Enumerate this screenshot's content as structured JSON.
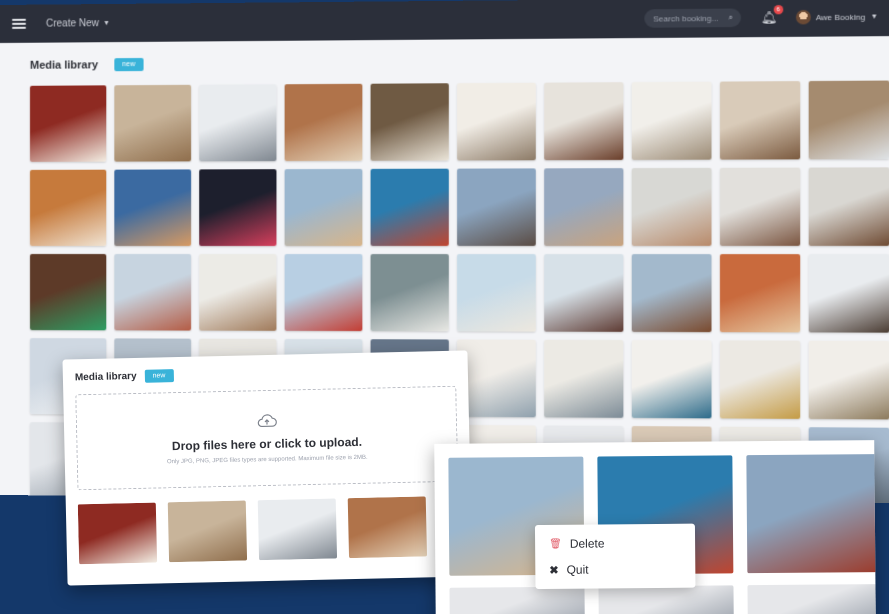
{
  "topbar": {
    "create_new_label": "Create New",
    "search_placeholder": "Search booking...",
    "notification_count": "6",
    "user_name": "Awe Booking"
  },
  "library": {
    "title": "Media library",
    "new_label": "new",
    "tiles": [
      {
        "colors": [
          "#8e2a22",
          "#f3ede3"
        ],
        "name": "media-tile-cafe-red"
      },
      {
        "colors": [
          "#c8b49a",
          "#8f6e4c"
        ],
        "name": "media-tile-office-hall"
      },
      {
        "colors": [
          "#e9ecef",
          "#7f8790"
        ],
        "name": "media-tile-living-gray"
      },
      {
        "colors": [
          "#b0734a",
          "#e3d1b8"
        ],
        "name": "media-tile-library-room"
      },
      {
        "colors": [
          "#6f5a43",
          "#eae4d8"
        ],
        "name": "media-tile-loft-living"
      },
      {
        "colors": [
          "#f1ede6",
          "#8c7a66"
        ],
        "name": "media-tile-dining"
      },
      {
        "colors": [
          "#e7e3dc",
          "#6a3e2a"
        ],
        "name": "media-tile-fireplace"
      },
      {
        "colors": [
          "#f1efea",
          "#9b8a74"
        ],
        "name": "media-tile-studio"
      },
      {
        "colors": [
          "#d9cbb9",
          "#7b5a3f"
        ],
        "name": "media-tile-lounge"
      },
      {
        "colors": [
          "#a58b6f",
          "#dfe3e6"
        ],
        "name": "media-tile-restaurant"
      },
      {
        "colors": [
          "#c67a3c",
          "#f0e3d2"
        ],
        "name": "media-tile-workspace"
      },
      {
        "colors": [
          "#3b6aa1",
          "#d79a62"
        ],
        "name": "media-tile-street-flags"
      },
      {
        "colors": [
          "#1d1f2d",
          "#d63f5c"
        ],
        "name": "media-tile-times-square"
      },
      {
        "colors": [
          "#9bb7cf",
          "#d8b58a"
        ],
        "name": "media-tile-beach"
      },
      {
        "colors": [
          "#2b7cae",
          "#c0452f"
        ],
        "name": "media-tile-golden-gate"
      },
      {
        "colors": [
          "#8ba5c0",
          "#5a4c44"
        ],
        "name": "media-tile-city-chicago"
      },
      {
        "colors": [
          "#96a8bf",
          "#c9a37e"
        ],
        "name": "media-tile-downtown"
      },
      {
        "colors": [
          "#d8d8d4",
          "#b88a6a"
        ],
        "name": "media-tile-man-glasses"
      },
      {
        "colors": [
          "#e2e0dc",
          "#7a5540"
        ],
        "name": "media-tile-woman-smile"
      },
      {
        "colors": [
          "#d9d7d2",
          "#6e4a32"
        ],
        "name": "media-tile-man-beard"
      },
      {
        "colors": [
          "#5d3a28",
          "#2e9d63"
        ],
        "name": "media-tile-man-green"
      },
      {
        "colors": [
          "#c7d4e0",
          "#b45c45"
        ],
        "name": "media-tile-row-houses"
      },
      {
        "colors": [
          "#ecebe6",
          "#a07a5a"
        ],
        "name": "media-tile-white-room"
      },
      {
        "colors": [
          "#b8cfe3",
          "#c33d33"
        ],
        "name": "media-tile-red-roof"
      },
      {
        "colors": [
          "#7d8f92",
          "#e8e8e4"
        ],
        "name": "media-tile-forest-cabin"
      },
      {
        "colors": [
          "#c7dbe8",
          "#ede8df"
        ],
        "name": "media-tile-white-house"
      },
      {
        "colors": [
          "#d7e1e8",
          "#5e3b33"
        ],
        "name": "media-tile-cottage"
      },
      {
        "colors": [
          "#a3b9cc",
          "#7a4a2e"
        ],
        "name": "media-tile-brick-house"
      },
      {
        "colors": [
          "#c96a3d",
          "#e6c7a1"
        ],
        "name": "media-tile-canyon"
      },
      {
        "colors": [
          "#e9ecef",
          "#4a3c33"
        ],
        "name": "media-tile-compass"
      },
      {
        "colors": [
          "#cfd8e2",
          "#eef0f2"
        ],
        "name": "media-tile-snow"
      },
      {
        "colors": [
          "#b4c0cc",
          "#8d98a4"
        ],
        "name": "media-tile-city-fog"
      },
      {
        "colors": [
          "#e8e6e1",
          "#8b7b66"
        ],
        "name": "media-tile-room-1"
      },
      {
        "colors": [
          "#d8e1e8",
          "#b3b6ba"
        ],
        "name": "media-tile-sky"
      },
      {
        "colors": [
          "#66768a",
          "#d9dde0"
        ],
        "name": "media-tile-mountain"
      },
      {
        "colors": [
          "#f0ede8",
          "#8fa0ad"
        ],
        "name": "media-tile-room-2"
      },
      {
        "colors": [
          "#eceae4",
          "#7c8b96"
        ],
        "name": "media-tile-living-blue"
      },
      {
        "colors": [
          "#f2f0ec",
          "#2d6b8a"
        ],
        "name": "media-tile-bedroom"
      },
      {
        "colors": [
          "#ece9e3",
          "#c49b45"
        ],
        "name": "media-tile-yellow-art"
      },
      {
        "colors": [
          "#f1eee9",
          "#8c7a5c"
        ],
        "name": "media-tile-wardrobe"
      },
      {
        "colors": [
          "#e3e6ea",
          "#9aa3ad"
        ],
        "name": "media-tile-room-3"
      },
      {
        "colors": [
          "#eef0f2",
          "#b8bec5"
        ],
        "name": "media-tile-room-4"
      },
      {
        "colors": [
          "#e8e4de",
          "#9a8f82"
        ],
        "name": "media-tile-room-5"
      },
      {
        "colors": [
          "#d4d8dd",
          "#6e7680"
        ],
        "name": "media-tile-room-6"
      },
      {
        "colors": [
          "#ebe8e2",
          "#a68a66"
        ],
        "name": "media-tile-room-7"
      },
      {
        "colors": [
          "#f0ede8",
          "#c8c2b8"
        ],
        "name": "media-tile-room-8"
      },
      {
        "colors": [
          "#e7e9ec",
          "#8f9aa4"
        ],
        "name": "media-tile-room-9"
      },
      {
        "colors": [
          "#d9c9b6",
          "#8b6a4a"
        ],
        "name": "media-tile-room-10"
      },
      {
        "colors": [
          "#eceae5",
          "#a3968a"
        ],
        "name": "media-tile-room-11"
      },
      {
        "colors": [
          "#a7bbd0",
          "#5d6a77"
        ],
        "name": "media-tile-skyline"
      }
    ]
  },
  "upload": {
    "title": "Media library",
    "new_label": "new",
    "drop_title": "Drop files here or click to upload.",
    "drop_sub": "Only JPG, PNG, JPEG files types are supported. Maximum file size is 2MB.",
    "thumbs": [
      {
        "colors": [
          "#8e2a22",
          "#f3ede3"
        ],
        "name": "upload-thumb-cafe"
      },
      {
        "colors": [
          "#c8b49a",
          "#8f6e4c"
        ],
        "name": "upload-thumb-office"
      },
      {
        "colors": [
          "#e9ecef",
          "#7f8790"
        ],
        "name": "upload-thumb-living"
      },
      {
        "colors": [
          "#b0734a",
          "#e3d1b8"
        ],
        "name": "upload-thumb-library"
      },
      {
        "colors": [
          "#6f5a43",
          "#eae4d8"
        ],
        "name": "upload-thumb-loft"
      }
    ]
  },
  "context": {
    "tiles": [
      {
        "colors": [
          "#9bb7cf",
          "#d8b58a"
        ],
        "name": "ctx-tile-beach"
      },
      {
        "colors": [
          "#2b7cae",
          "#c0452f"
        ],
        "name": "ctx-tile-golden-gate"
      },
      {
        "colors": [
          "#8ba5c0",
          "#9c3a2a"
        ],
        "name": "ctx-tile-chicago"
      }
    ],
    "menu": {
      "delete_label": "Delete",
      "quit_label": "Quit"
    }
  }
}
